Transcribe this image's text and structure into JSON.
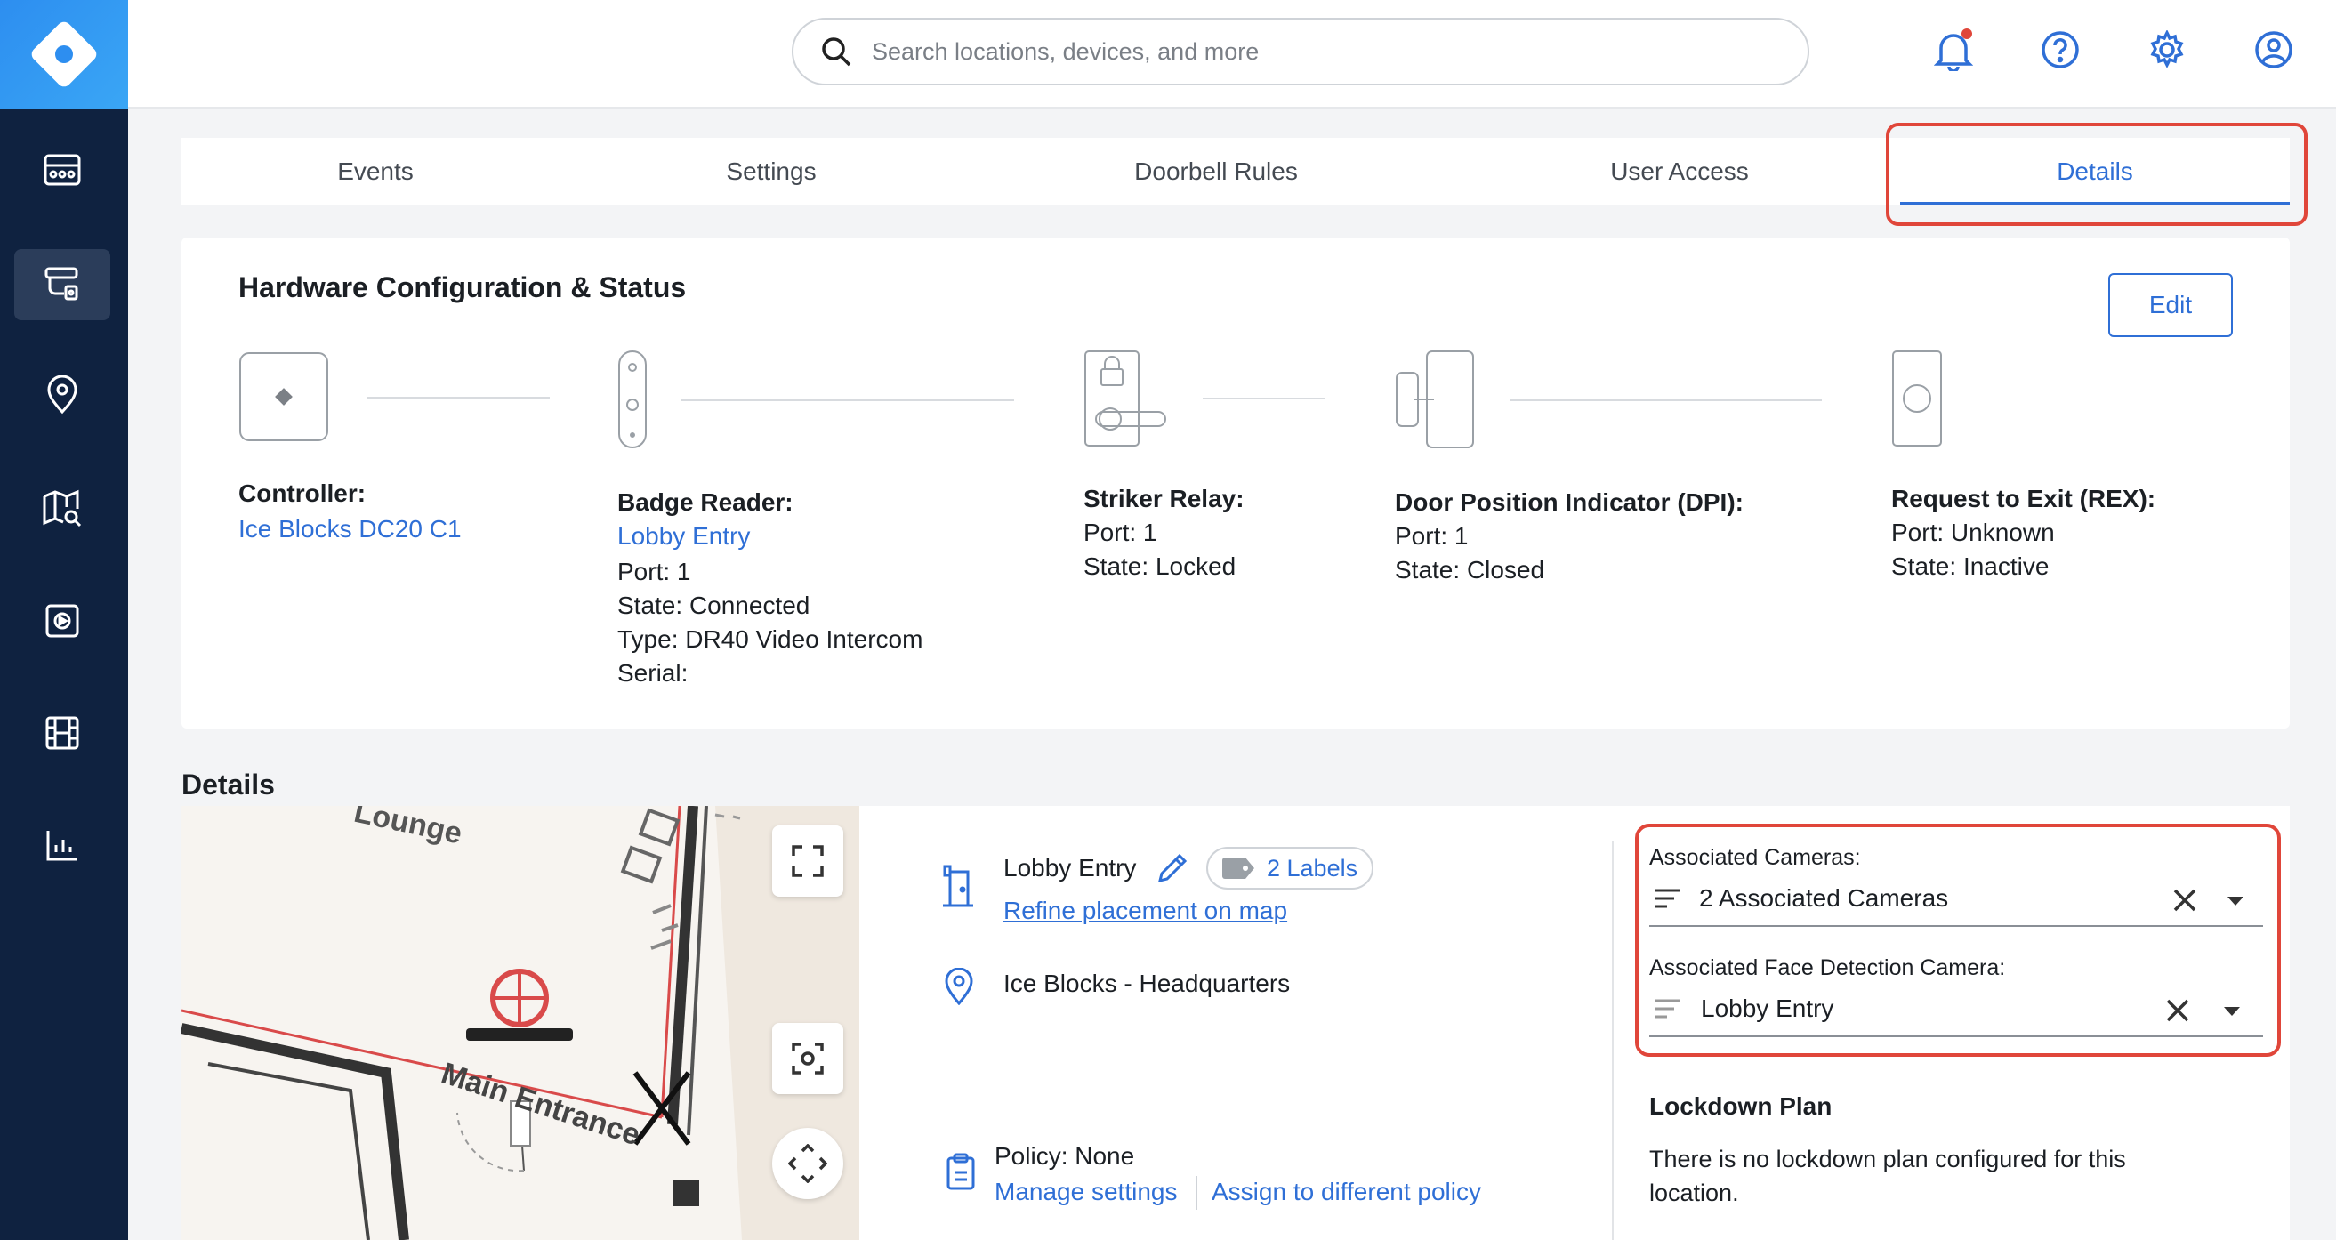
{
  "header": {
    "search_placeholder": "Search locations, devices, and more"
  },
  "tabs": [
    {
      "label": "Events"
    },
    {
      "label": "Settings"
    },
    {
      "label": "Doorbell Rules"
    },
    {
      "label": "User Access"
    },
    {
      "label": "Details"
    }
  ],
  "hardware": {
    "title": "Hardware Configuration & Status",
    "edit_label": "Edit",
    "controller": {
      "label": "Controller:",
      "name": "Ice Blocks DC20 C1"
    },
    "badge_reader": {
      "label": "Badge Reader:",
      "name": "Lobby Entry",
      "port": "Port: 1",
      "state": "State: Connected",
      "type": "Type: DR40 Video Intercom",
      "serial": "Serial:"
    },
    "striker_relay": {
      "label": "Striker Relay:",
      "port": "Port: 1",
      "state": "State: Locked"
    },
    "dpi": {
      "label": "Door Position Indicator (DPI):",
      "port": "Port: 1",
      "state": "State: Closed"
    },
    "rex": {
      "label": "Request to Exit (REX):",
      "port": "Port: Unknown",
      "state": "State: Inactive"
    }
  },
  "details": {
    "title": "Details",
    "map_labels": {
      "lounge": "Lounge",
      "main_entrance": "Main Entrance"
    },
    "door_name": "Lobby Entry",
    "labels_badge": "2 Labels",
    "refine_link": "Refine placement on map",
    "location": "Ice Blocks - Headquarters",
    "policy": "Policy: None",
    "manage_settings": "Manage settings",
    "assign_policy": "Assign to different policy",
    "associated_cameras_label": "Associated Cameras:",
    "associated_cameras_value": "2 Associated Cameras",
    "face_camera_label": "Associated Face Detection Camera:",
    "face_camera_value": "Lobby Entry",
    "lockdown_title": "Lockdown Plan",
    "lockdown_text": "There is no lockdown plan configured for this location."
  },
  "colors": {
    "accent": "#2f6fd6",
    "sidebar": "#0f2240",
    "highlight": "#e0463a",
    "notification_dot": "#e0463a"
  },
  "icons": {
    "sidebar": [
      "dashboard-icon",
      "access-control-icon",
      "location-pin-icon",
      "map-search-icon",
      "camera-icon",
      "film-icon",
      "analytics-icon"
    ],
    "header": [
      "bell-icon",
      "help-icon",
      "gear-icon",
      "user-icon"
    ]
  }
}
